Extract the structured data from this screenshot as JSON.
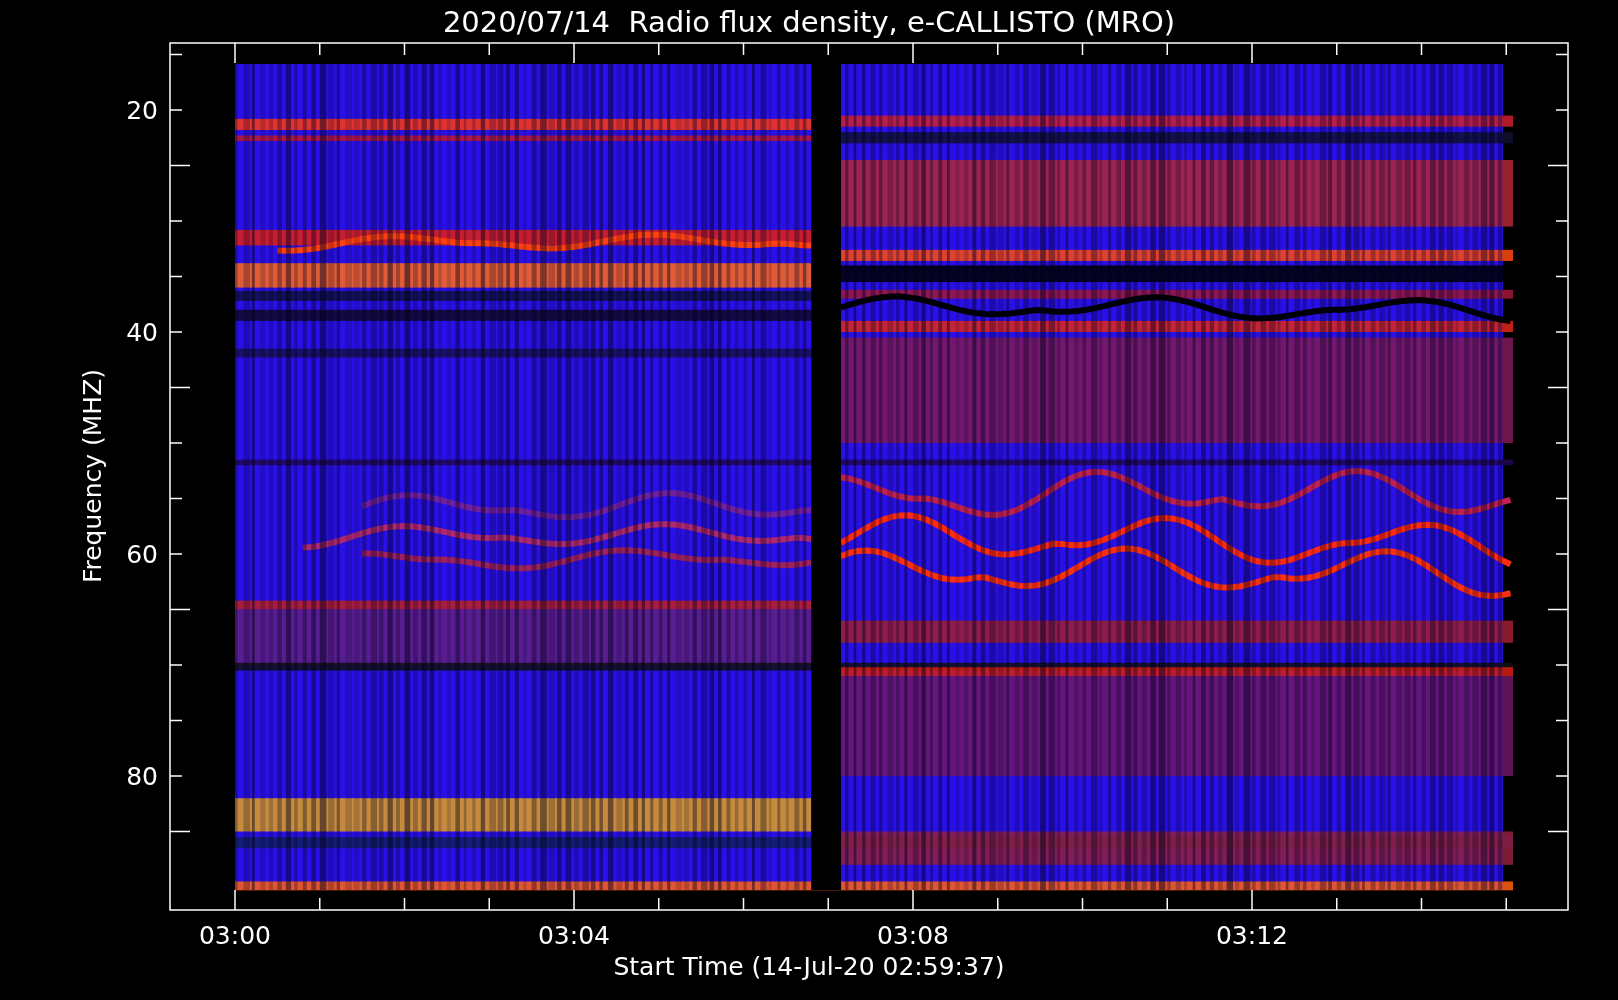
{
  "title": "2020/07/14  Radio flux density, e-CALLISTO (MRO)",
  "ylabel": "Frequency (MHZ)",
  "xlabel": "Start Time (14-Jul-20 02:59:37)",
  "yticks": [
    "20",
    "40",
    "60",
    "80"
  ],
  "xticks": [
    "03:00",
    "03:04",
    "03:08",
    "03:12"
  ]
}
